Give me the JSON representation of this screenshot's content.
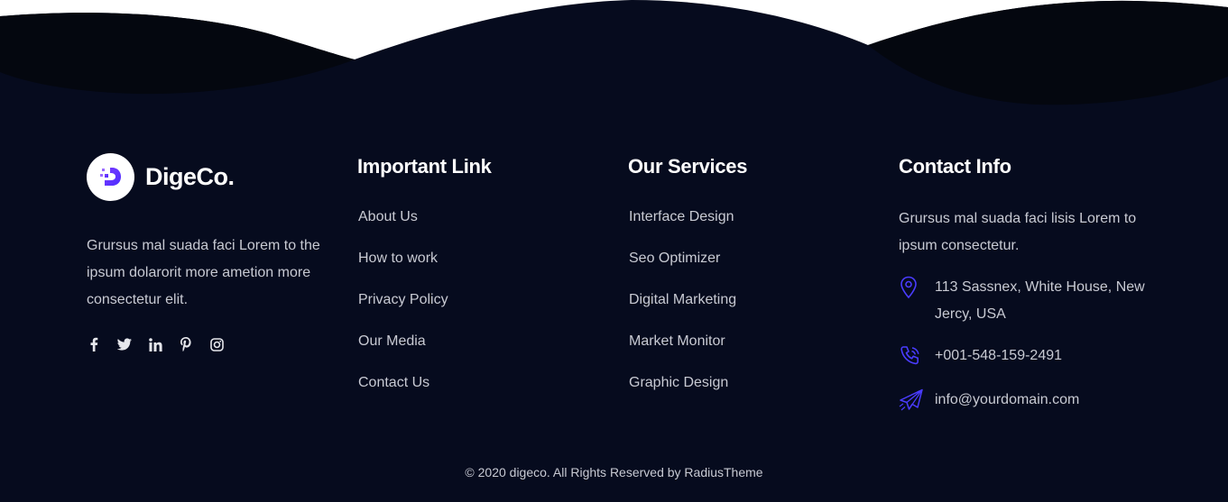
{
  "colors": {
    "background": "#060b1e",
    "wave_dark": "#04070f",
    "accent": "#5b3bff",
    "text": "#c8cad3",
    "heading": "#ffffff"
  },
  "brand": {
    "name": "DigeCo.",
    "logo_letter": "D",
    "tagline": "Grursus mal suada faci Lorem to the ipsum dolarorit more ametion more consectetur elit.",
    "social_icons": [
      "facebook-icon",
      "twitter-icon",
      "linkedin-icon",
      "pinterest-icon",
      "instagram-icon"
    ]
  },
  "important_links": {
    "title": "Important Link",
    "items": [
      "About Us",
      "How to work",
      "Privacy Policy",
      "Our Media",
      "Contact Us"
    ]
  },
  "services": {
    "title": "Our Services",
    "items": [
      "Interface Design",
      "Seo Optimizer",
      "Digital Marketing",
      "Market Monitor",
      "Graphic Design"
    ]
  },
  "contact": {
    "title": "Contact Info",
    "intro": "Grursus mal suada faci lisis Lorem to ipsum consectetur.",
    "address": "113 Sassnex, White House, New Jercy, USA",
    "phone": "+001-548-159-2491",
    "email": "info@yourdomain.com"
  },
  "copyright": "© 2020 digeco. All Rights Reserved by RadiusTheme"
}
